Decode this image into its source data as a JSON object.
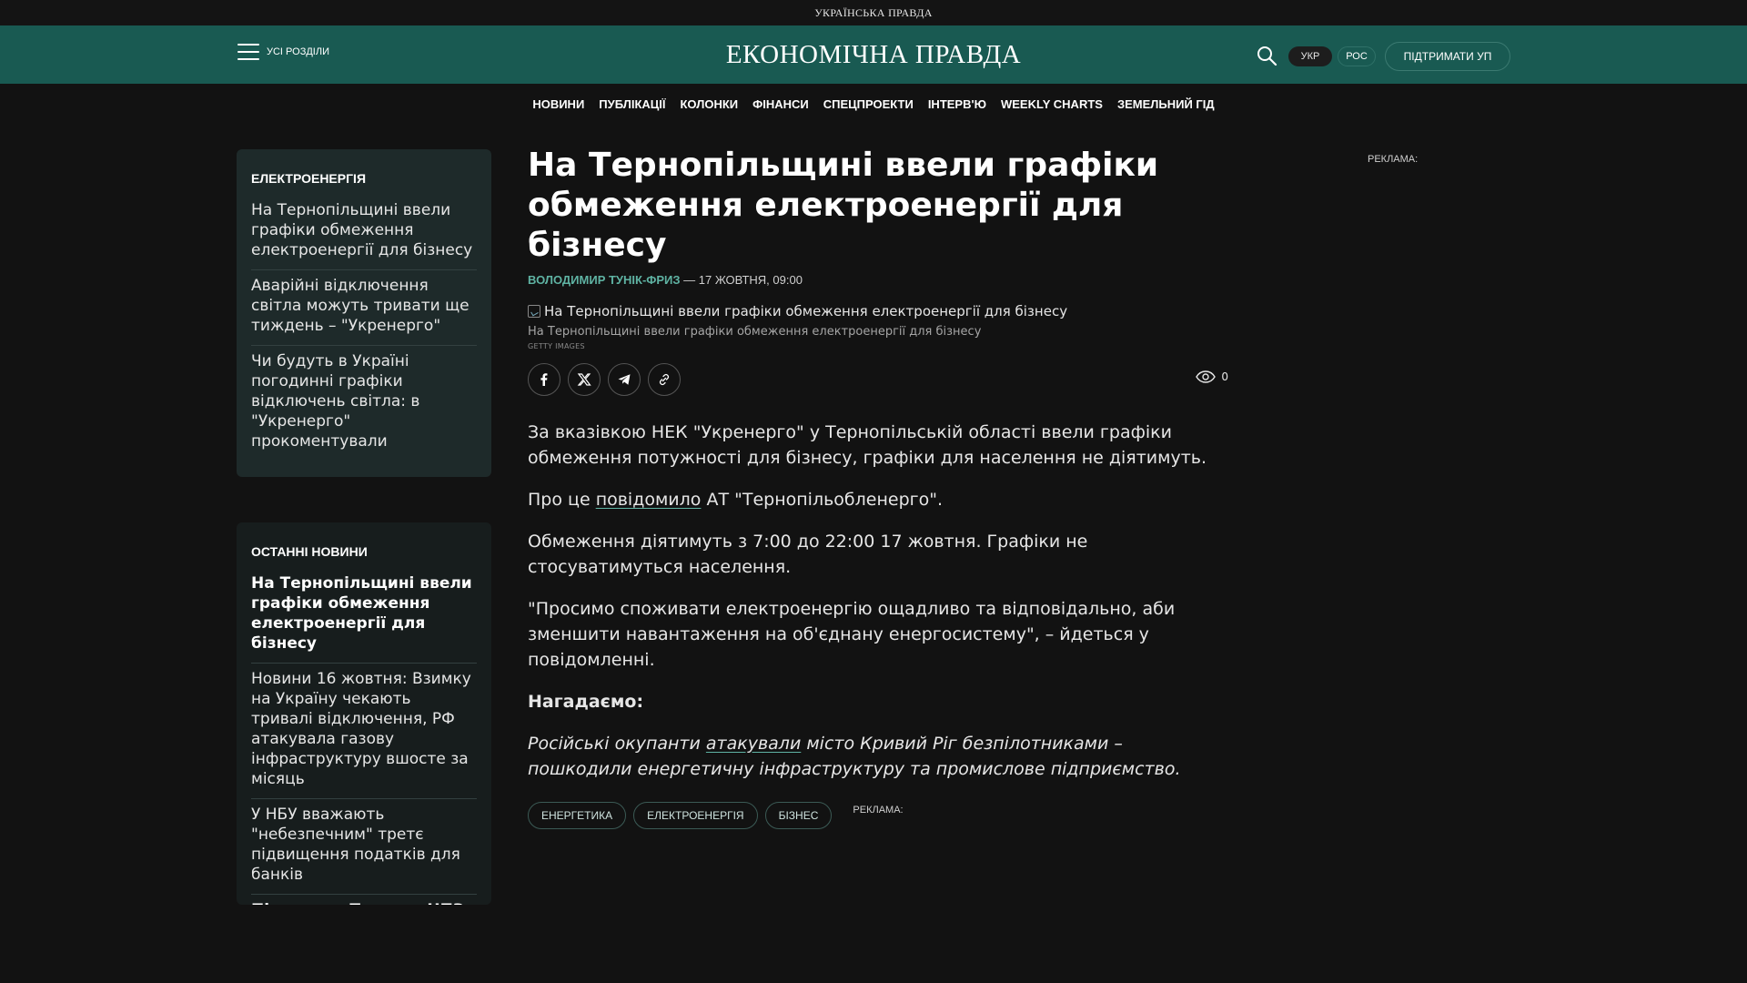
{
  "top_brand": "УКРАЇНСЬКА ПРАВДА",
  "header": {
    "menu_label": "УСІ РОЗДІЛИ",
    "logo": "ЕКОНОМІЧНА ПРАВДА",
    "lang_ua": "УКР",
    "lang_ru": "РОС",
    "support": "ПІДТРИМАТИ УП",
    "icons": [
      "menu-icon",
      "search-icon"
    ]
  },
  "nav": [
    "НОВИНИ",
    "ПУБЛІКАЦІЇ",
    "КОЛОНКИ",
    "ФІНАНСИ",
    "СПЕЦПРОЕКТИ",
    "ІНТЕРВ'Ю",
    "WEEKLY CHARTS",
    "ЗЕМЕЛЬНИЙ ГІД"
  ],
  "topic_card": {
    "title": "ЕЛЕКТРОЕНЕРГІЯ",
    "items": [
      "На Тернопільщині ввели графіки обмеження електроенергії для бізнесу",
      "Аварійні відключення світла можуть тривати ще тиждень – \"Укренерго\"",
      "Чи будуть в Україні погодинні графіки відключень світла: в \"Укренерго\" прокоментували"
    ]
  },
  "latest_news": {
    "title": "ОСТАННІ НОВИНИ",
    "items": [
      "На Тернопільщині ввели графіки обмеження електроенергії для бізнесу",
      "Новини 16 жовтня: Взимку на Україну чекають тривалі відключення, РФ атакувала газову інфраструктуру вшосте за місяць",
      "У НБУ вважають \"небезпечним\" третє підвищення податків для банків",
      "Після заяв Трампа: НПЗ Індії сигналізують про відмову"
    ]
  },
  "article": {
    "title": "На Тернопільщині ввели графіки обмеження електроенергії для бізнесу",
    "author": "ВОЛОДИМИР ТУНІК-ФРИЗ",
    "datetime": " — 17 ЖОВТНЯ, 09:00",
    "image_alt": "На Тернопільщині ввели графіки обмеження електроенергії для бізнесу",
    "caption": "На Тернопільщині ввели графіки обмеження електроенергії для бізнесу",
    "credit": "GETTY IMAGES",
    "views": "0",
    "p1": "За вказівкою НЕК \"Укренерго\" у Тернопільській області ввели графіки обмеження потужності для бізнесу, графіки для населення не діятимуть.",
    "p2_pre": "Про це ",
    "p2_link": "повідомило",
    "p2_post": " АТ \"Тернопільобленерго\".",
    "p3": "Обмеження діятимуть з 7:00 до 22:00 17 жовтня. Графіки не стосуватимуться населення.",
    "p4": "\"Просимо споживати електроенергію ощадливо та відповідально, аби зменшити навантаження на об'єднану енергосистему\", – йдеться у повідомленні.",
    "p5": "Нагадаємо:",
    "p6_pre": "Російські окупанти ",
    "p6_link": "атакували",
    "p6_post": " місто Кривий Ріг безпілотниками – пошкодили енергетичну інфраструктуру та промислове підприємство.",
    "tags": [
      "ЕНЕРГЕТИКА",
      "ЕЛЕКТРОЕНЕРГІЯ",
      "БІЗНЕС"
    ],
    "share_icons": [
      "facebook-icon",
      "x-icon",
      "telegram-icon",
      "copy-link-icon"
    ]
  },
  "ads": {
    "right": "РЕКЛАМА:",
    "bottom": "РЕКЛАМА:"
  },
  "colors": {
    "header_bg": "#195a52",
    "page_bg": "#121212",
    "accent": "#5fb3a3"
  }
}
